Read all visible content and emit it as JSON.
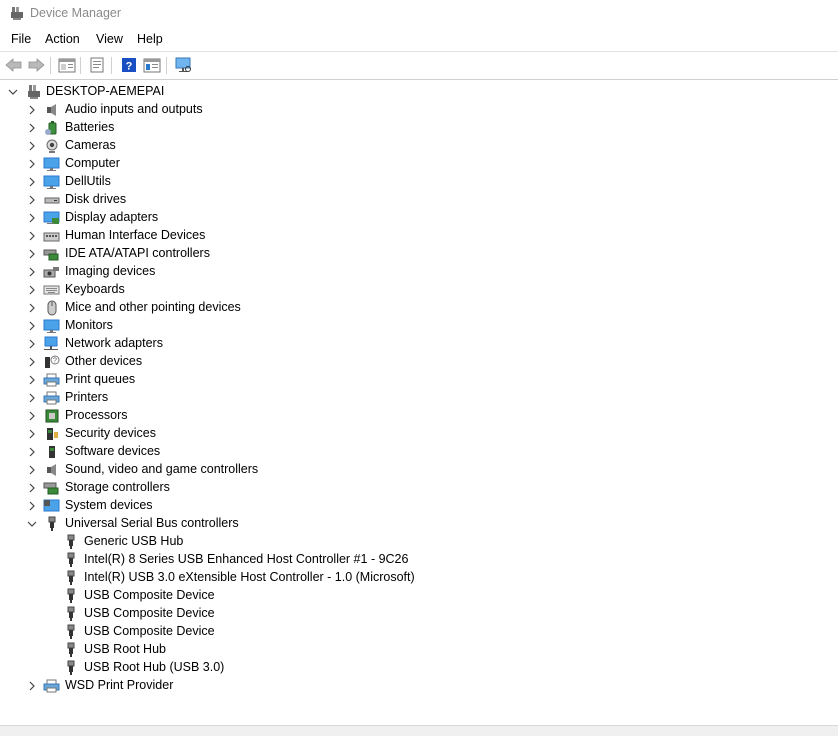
{
  "window": {
    "title": "Device Manager"
  },
  "menu": {
    "items": [
      "File",
      "Action",
      "View",
      "Help"
    ]
  },
  "toolbar": {
    "buttons": [
      "back-arrow-icon",
      "forward-arrow-icon",
      "show-hide-console-tree-icon",
      "properties-icon",
      "help-icon",
      "view-icon",
      "scan-hardware-icon"
    ]
  },
  "tree": {
    "root": "DESKTOP-AEMEPAI",
    "categories": [
      {
        "label": "Audio inputs and outputs",
        "icon": "speaker-icon"
      },
      {
        "label": "Batteries",
        "icon": "battery-icon"
      },
      {
        "label": "Cameras",
        "icon": "camera-icon"
      },
      {
        "label": "Computer",
        "icon": "monitor-icon"
      },
      {
        "label": "DellUtils",
        "icon": "monitor-icon"
      },
      {
        "label": "Disk drives",
        "icon": "disk-drive-icon"
      },
      {
        "label": "Display adapters",
        "icon": "display-adapter-icon"
      },
      {
        "label": "Human Interface Devices",
        "icon": "hid-icon"
      },
      {
        "label": "IDE ATA/ATAPI controllers",
        "icon": "ide-controller-icon"
      },
      {
        "label": "Imaging devices",
        "icon": "imaging-icon"
      },
      {
        "label": "Keyboards",
        "icon": "keyboard-icon"
      },
      {
        "label": "Mice and other pointing devices",
        "icon": "mouse-icon"
      },
      {
        "label": "Monitors",
        "icon": "monitor-icon"
      },
      {
        "label": "Network adapters",
        "icon": "network-icon"
      },
      {
        "label": "Other devices",
        "icon": "unknown-device-icon"
      },
      {
        "label": "Print queues",
        "icon": "printer-icon"
      },
      {
        "label": "Printers",
        "icon": "printer-icon"
      },
      {
        "label": "Processors",
        "icon": "processor-icon"
      },
      {
        "label": "Security devices",
        "icon": "security-device-icon"
      },
      {
        "label": "Software devices",
        "icon": "software-device-icon"
      },
      {
        "label": "Sound, video and game controllers",
        "icon": "speaker-icon"
      },
      {
        "label": "Storage controllers",
        "icon": "storage-controller-icon"
      },
      {
        "label": "System devices",
        "icon": "system-device-icon"
      },
      {
        "label": "Universal Serial Bus controllers",
        "icon": "usb-icon",
        "expanded": true,
        "children": [
          "Generic USB Hub",
          "Intel(R) 8 Series USB Enhanced Host Controller #1 - 9C26",
          "Intel(R) USB 3.0 eXtensible Host Controller - 1.0 (Microsoft)",
          "USB Composite Device",
          "USB Composite Device",
          "USB Composite Device",
          "USB Root Hub",
          "USB Root Hub (USB 3.0)"
        ]
      },
      {
        "label": "WSD Print Provider",
        "icon": "printer-icon"
      }
    ]
  },
  "colors": {
    "title_text": "#8a8a8a",
    "accent_blue": "#2b79d0",
    "help_blue": "#1a4fc4"
  }
}
